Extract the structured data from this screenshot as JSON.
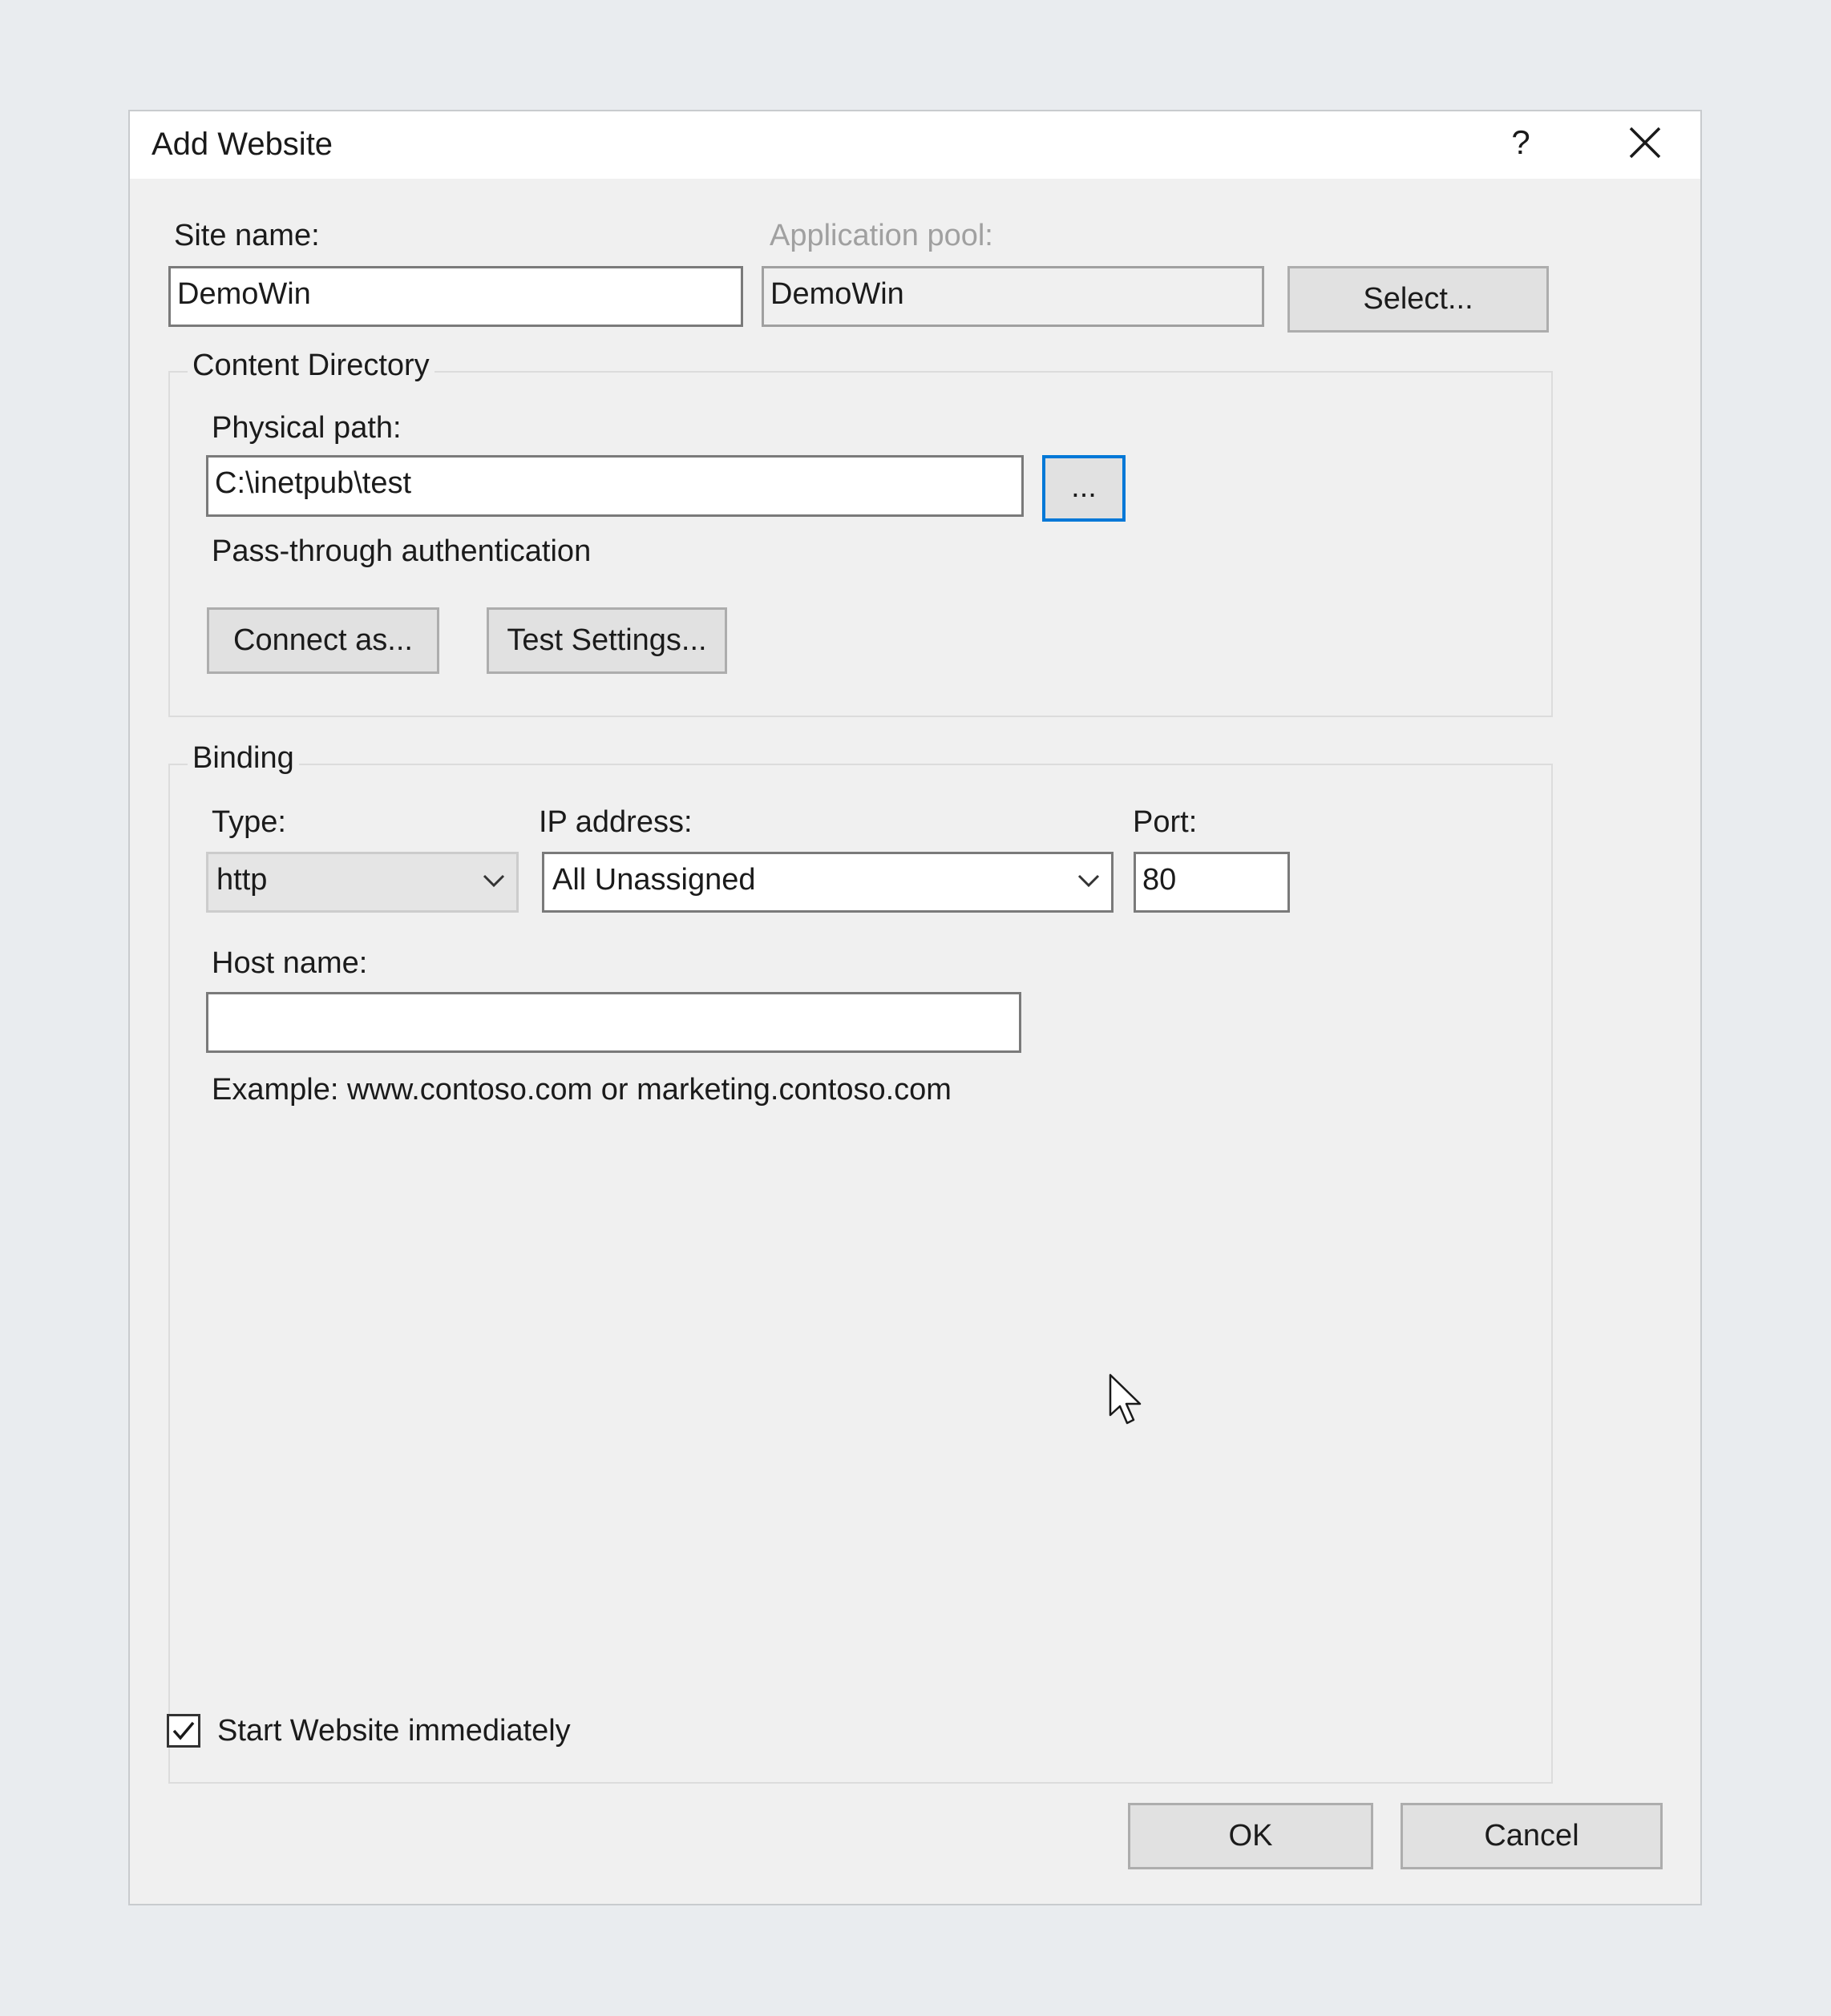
{
  "dialog": {
    "title": "Add Website",
    "help_glyph": "?",
    "close_icon": "close-icon"
  },
  "site": {
    "site_name_label": "Site name:",
    "site_name_value": "DemoWin",
    "app_pool_label": "Application pool:",
    "app_pool_value": "DemoWin",
    "select_button": "Select..."
  },
  "content_directory": {
    "legend": "Content Directory",
    "physical_path_label": "Physical path:",
    "physical_path_value": "C:\\inetpub\\test",
    "browse_button": "...",
    "pass_through_label": "Pass-through authentication",
    "connect_as_button": "Connect as...",
    "test_settings_button": "Test Settings..."
  },
  "binding": {
    "legend": "Binding",
    "type_label": "Type:",
    "type_value": "http",
    "ip_label": "IP address:",
    "ip_value": "All Unassigned",
    "port_label": "Port:",
    "port_value": "80",
    "host_name_label": "Host name:",
    "host_name_value": "",
    "example_text": "Example: www.contoso.com or marketing.contoso.com"
  },
  "start_immediately": {
    "label": "Start Website immediately",
    "checked": true
  },
  "footer": {
    "ok_button": "OK",
    "cancel_button": "Cancel"
  },
  "colors": {
    "focus_accent": "#0078d7",
    "dialog_bg": "#f0f0f0",
    "page_bg": "#e9ecef"
  }
}
